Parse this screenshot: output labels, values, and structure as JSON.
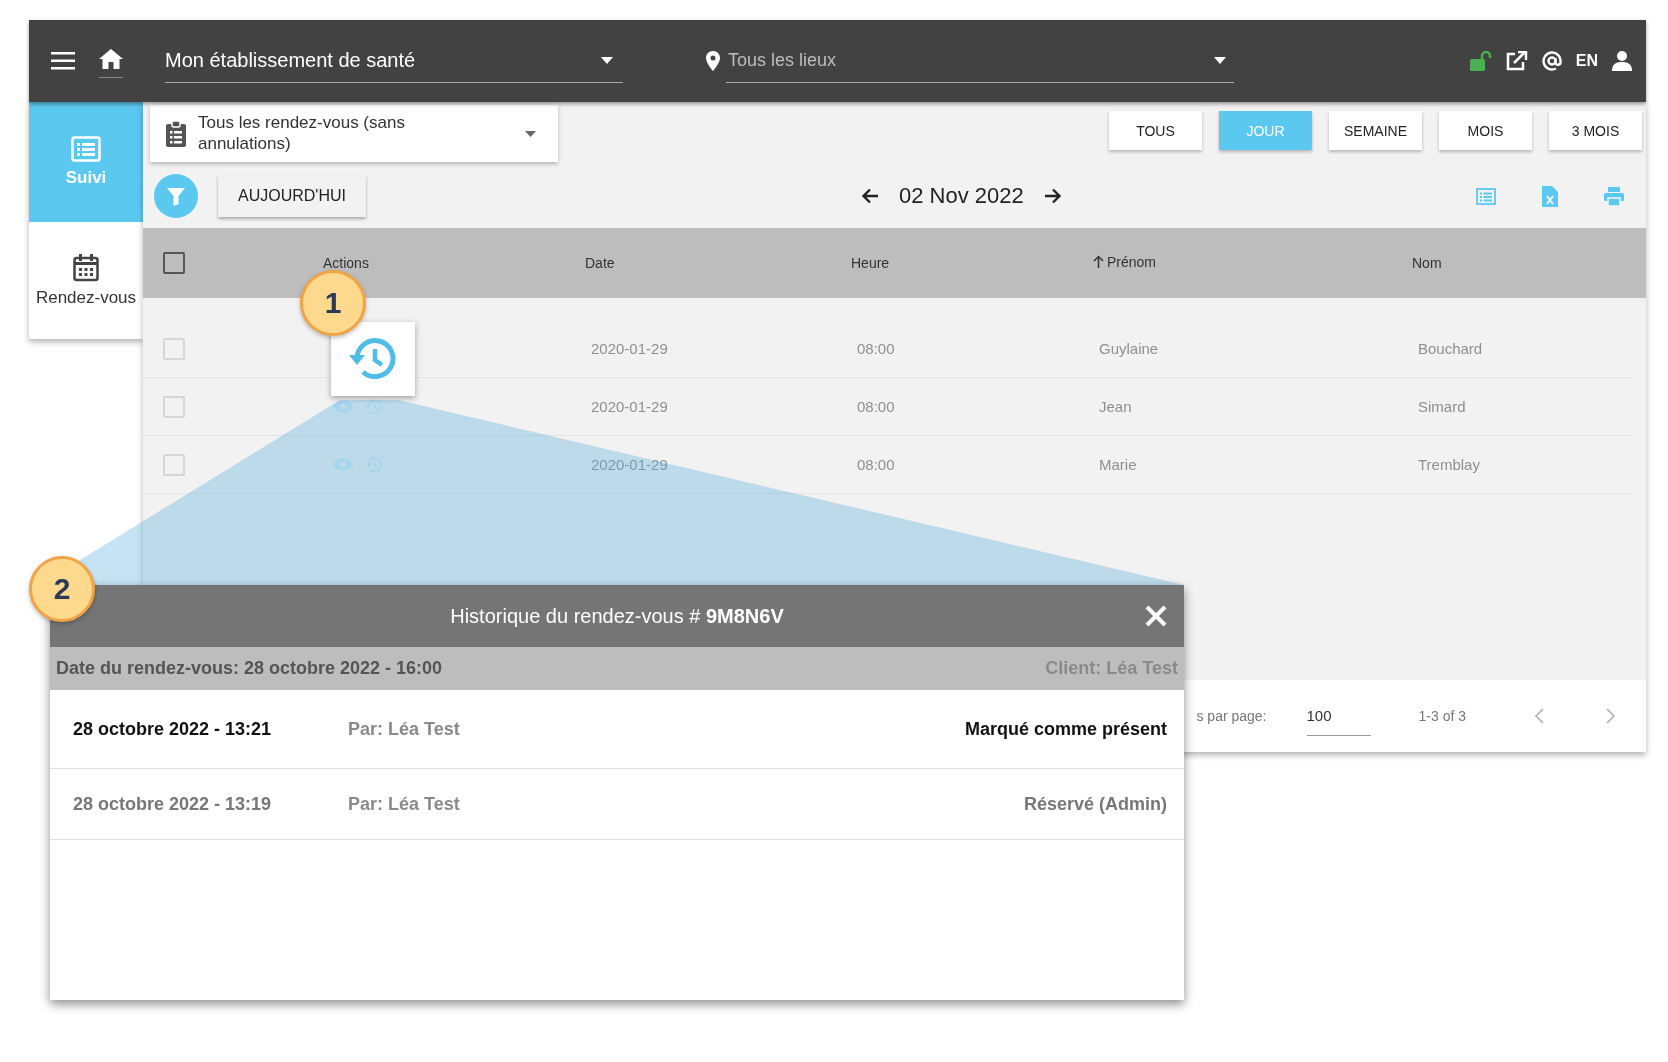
{
  "top_bar": {
    "establishment": "Mon établissement de santé",
    "location_placeholder": "Tous les lieux",
    "language": "EN"
  },
  "sidebar": {
    "items": [
      {
        "label": "Suivi",
        "kind": "list",
        "selected": true
      },
      {
        "label": "Rendez-vous",
        "kind": "calendar",
        "selected": false
      }
    ]
  },
  "filter": {
    "value": "Tous les rendez-vous (sans annulations)"
  },
  "view_buttons": [
    {
      "label": "TOUS",
      "selected": false
    },
    {
      "label": "JOUR",
      "selected": true
    },
    {
      "label": "SEMAINE",
      "selected": false
    },
    {
      "label": "MOIS",
      "selected": false
    },
    {
      "label": "3 MOIS",
      "selected": false
    }
  ],
  "today_button": "AUJOURD'HUI",
  "current_date": "02 Nov 2022",
  "table": {
    "select_all_checked": false,
    "columns": [
      {
        "label": "Actions",
        "sorted": false
      },
      {
        "label": "Date",
        "sorted": false
      },
      {
        "label": "Heure",
        "sorted": false
      },
      {
        "label": "Prénom",
        "sorted": true
      },
      {
        "label": "Nom",
        "sorted": false
      }
    ],
    "rows": [
      {
        "checked": false,
        "highlighted": true,
        "date": "2020-01-29",
        "time": "08:00",
        "first_name": "Guylaine",
        "last_name": "Bouchard"
      },
      {
        "checked": false,
        "highlighted": false,
        "date": "2020-01-29",
        "time": "08:00",
        "first_name": "Jean",
        "last_name": "Simard"
      },
      {
        "checked": false,
        "highlighted": false,
        "date": "2020-01-29",
        "time": "08:00",
        "first_name": "Marie",
        "last_name": "Tremblay"
      }
    ]
  },
  "pagination": {
    "rows_per_page_label": "s par page:",
    "rows_per_page": "100",
    "range": "1-3 of 3"
  },
  "callouts": [
    {
      "label": "1"
    },
    {
      "label": "2"
    }
  ],
  "dialog": {
    "title": "Historique du rendez-vous # **9M8N6V**",
    "appointment_date": "Date du rendez-vous: 28 octobre 2022 - 16:00",
    "client": "Client: Léa Test",
    "entries": [
      {
        "time": "28 octobre 2022 - 13:21",
        "by": "Par: Léa Test",
        "action": "Marqué comme présent",
        "latest": true
      },
      {
        "time": "28 octobre 2022 - 13:19",
        "by": "Par: Léa Test",
        "action": "Réservé (Admin)",
        "latest": false
      }
    ]
  }
}
